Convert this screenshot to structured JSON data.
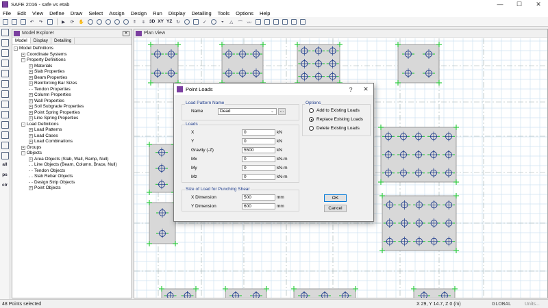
{
  "window": {
    "title": "SAFE 2016 - safe vs etab",
    "minimize": "—",
    "maximize": "☐",
    "close": "✕"
  },
  "menu": [
    "File",
    "Edit",
    "View",
    "Define",
    "Draw",
    "Select",
    "Assign",
    "Design",
    "Run",
    "Display",
    "Detailing",
    "Tools",
    "Options",
    "Help"
  ],
  "toolbar": {
    "labels": [
      "3D",
      "XY",
      "YZ"
    ]
  },
  "left_toolbar": {
    "labels": [
      "all",
      "ps",
      "clr"
    ]
  },
  "model_explorer": {
    "title": "Model Explorer",
    "tabs": [
      "Model",
      "Display",
      "Detailing"
    ],
    "tree": [
      {
        "label": "Model Definitions",
        "level": 0,
        "expander": "-"
      },
      {
        "label": "Coordinate Systems",
        "level": 1,
        "expander": "+"
      },
      {
        "label": "Property Definitions",
        "level": 1,
        "expander": "-"
      },
      {
        "label": "Materials",
        "level": 2,
        "expander": "+"
      },
      {
        "label": "Slab Properties",
        "level": 2,
        "expander": "+"
      },
      {
        "label": "Beam Properties",
        "level": 2,
        "expander": "+"
      },
      {
        "label": "Reinforcing Bar Sizes",
        "level": 2,
        "expander": "+"
      },
      {
        "label": "Tendon Properties",
        "level": 2,
        "expander": ""
      },
      {
        "label": "Column Properties",
        "level": 2,
        "expander": "+"
      },
      {
        "label": "Wall Properties",
        "level": 2,
        "expander": "+"
      },
      {
        "label": "Soil Subgrade Properties",
        "level": 2,
        "expander": "+"
      },
      {
        "label": "Point Spring Properties",
        "level": 2,
        "expander": "+"
      },
      {
        "label": "Line Spring Properties",
        "level": 2,
        "expander": "+"
      },
      {
        "label": "Load Definitions",
        "level": 1,
        "expander": "-"
      },
      {
        "label": "Load Patterns",
        "level": 2,
        "expander": "+"
      },
      {
        "label": "Load Cases",
        "level": 2,
        "expander": "+"
      },
      {
        "label": "Load Combinations",
        "level": 2,
        "expander": "+"
      },
      {
        "label": "Groups",
        "level": 1,
        "expander": "+"
      },
      {
        "label": "Objects",
        "level": 1,
        "expander": "-"
      },
      {
        "label": "Area Objects (Slab, Wall, Ramp, Null)",
        "level": 2,
        "expander": "+"
      },
      {
        "label": "Line Objects (Beam, Column, Brace, Null)",
        "level": 2,
        "expander": ""
      },
      {
        "label": "Tendon Objects",
        "level": 2,
        "expander": ""
      },
      {
        "label": "Slab Rebar Objects",
        "level": 2,
        "expander": ""
      },
      {
        "label": "Design Strip Objects",
        "level": 2,
        "expander": ""
      },
      {
        "label": "Point Objects",
        "level": 2,
        "expander": "+"
      }
    ]
  },
  "plan_view": {
    "title": "Plan View"
  },
  "dialog": {
    "title": "Point Loads",
    "help": "?",
    "close": "✕",
    "load_pattern": {
      "group": "Load Pattern Name",
      "name_label": "Name",
      "value": "Dead",
      "more_button": "..."
    },
    "loads": {
      "group": "Loads",
      "rows": [
        {
          "label": "X",
          "value": "0",
          "unit": "kN"
        },
        {
          "label": "Y",
          "value": "0",
          "unit": "kN"
        },
        {
          "label": "Gravity (-Z)",
          "value": "5500",
          "unit": "kN"
        },
        {
          "label": "Mx",
          "value": "0",
          "unit": "kN-m"
        },
        {
          "label": "My",
          "value": "0",
          "unit": "kN-m"
        },
        {
          "label": "Mz",
          "value": "0",
          "unit": "kN-m"
        }
      ]
    },
    "punching": {
      "group": "Size of Load for Punching Shear",
      "rows": [
        {
          "label": "X Dimension",
          "value": "500",
          "unit": "mm"
        },
        {
          "label": "Y Dimension",
          "value": "600",
          "unit": "mm"
        }
      ]
    },
    "options": {
      "group": "Options",
      "items": [
        "Add to Existing Loads",
        "Replace Existing Loads",
        "Delete Existing Loads"
      ],
      "selected": 1
    },
    "ok": "OK",
    "cancel": "Cancel"
  },
  "status": {
    "left": "48 Points selected",
    "coords": "X 29,  Y 14.7,  Z 0  (m)",
    "coord_system": "GLOBAL",
    "units": "Units..."
  },
  "colors": {
    "accent": "#7b3fa0",
    "grid": "#cfe3f2",
    "slab": "#d8d8d8",
    "point": "#2ecc40",
    "column": "#1e3c8c"
  }
}
